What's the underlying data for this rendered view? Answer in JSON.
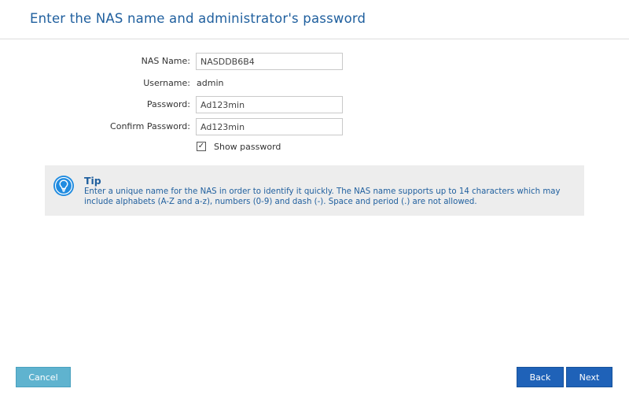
{
  "header": {
    "title": "Enter the NAS name and administrator's password"
  },
  "form": {
    "nas_name": {
      "label": "NAS Name:",
      "value": "NASDDB6B4"
    },
    "username": {
      "label": "Username:",
      "value": "admin"
    },
    "password": {
      "label": "Password:",
      "value": "Ad123min"
    },
    "confirm_password": {
      "label": "Confirm Password:",
      "value": "Ad123min"
    },
    "show_password": {
      "label": "Show password",
      "checked": true
    }
  },
  "tip": {
    "icon": "lightbulb-icon",
    "title": "Tip",
    "text": "Enter a unique name for the NAS in order to identify it quickly. The NAS name supports up to 14 characters which may include alphabets (A-Z and a-z), numbers (0-9) and dash (-). Space and period (.) are not allowed."
  },
  "footer": {
    "cancel_label": "Cancel",
    "back_label": "Back",
    "next_label": "Next"
  },
  "colors": {
    "title": "#1f5f9e",
    "tip_background": "#ededed",
    "cancel_button": "#5fb3cf",
    "primary_button": "#1f62b8"
  }
}
